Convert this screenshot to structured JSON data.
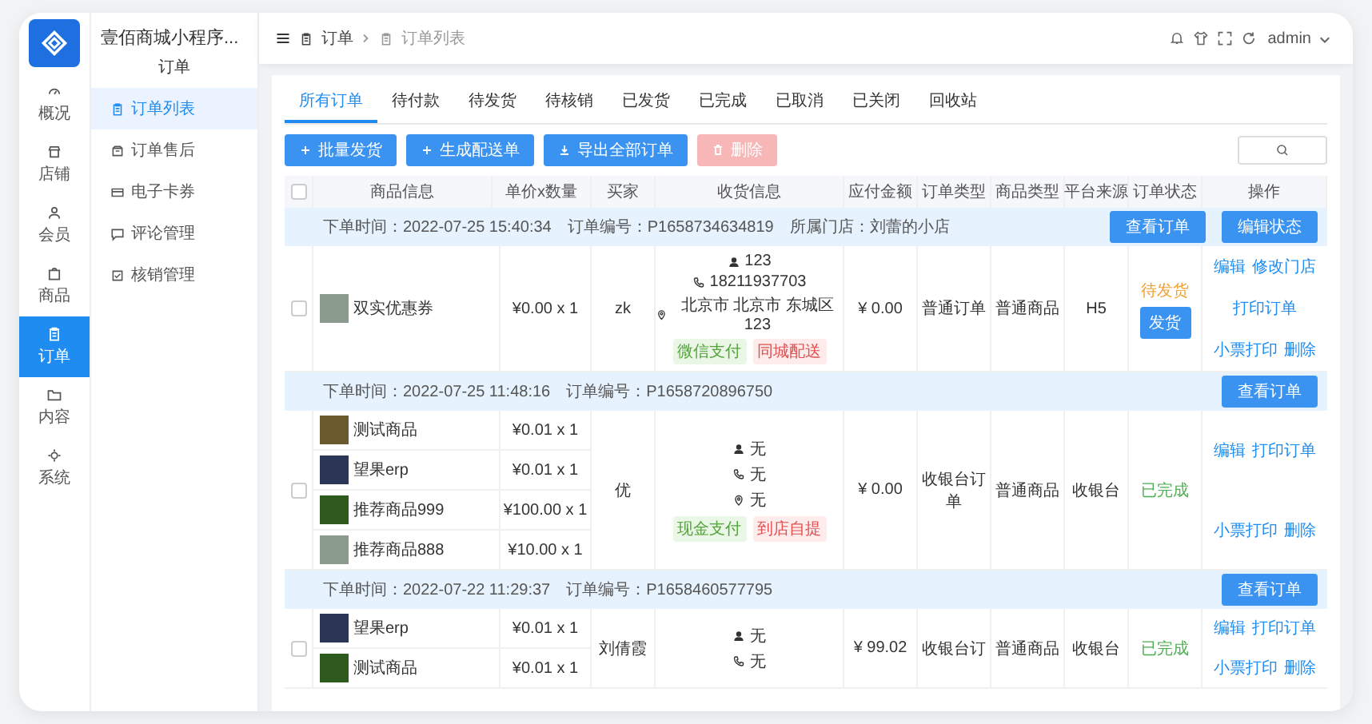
{
  "brand": {
    "title": "壹佰商城小程序..."
  },
  "rail": [
    {
      "label": "概况",
      "kind": "gauge",
      "selected": false
    },
    {
      "label": "店铺",
      "kind": "shop",
      "selected": false
    },
    {
      "label": "会员",
      "kind": "user",
      "selected": false
    },
    {
      "label": "商品",
      "kind": "bag",
      "selected": false
    },
    {
      "label": "订单",
      "kind": "order",
      "selected": true
    },
    {
      "label": "内容",
      "kind": "folder",
      "selected": false
    },
    {
      "label": "系统",
      "kind": "gear",
      "selected": false
    }
  ],
  "subnav": {
    "title": "订单",
    "items": [
      {
        "label": "订单列表",
        "kind": "list",
        "selected": true
      },
      {
        "label": "订单售后",
        "kind": "aftersale",
        "selected": false
      },
      {
        "label": "电子卡券",
        "kind": "card",
        "selected": false
      },
      {
        "label": "评论管理",
        "kind": "comment",
        "selected": false
      },
      {
        "label": "核销管理",
        "kind": "verify",
        "selected": false
      }
    ]
  },
  "breadcrumb": [
    "订单",
    "订单列表"
  ],
  "user": {
    "name": "admin"
  },
  "tabs": [
    {
      "label": "所有订单",
      "selected": true
    },
    {
      "label": "待付款",
      "selected": false
    },
    {
      "label": "待发货",
      "selected": false
    },
    {
      "label": "待核销",
      "selected": false
    },
    {
      "label": "已发货",
      "selected": false
    },
    {
      "label": "已完成",
      "selected": false
    },
    {
      "label": "已取消",
      "selected": false
    },
    {
      "label": "已关闭",
      "selected": false
    },
    {
      "label": "回收站",
      "selected": false
    }
  ],
  "toolbar": [
    {
      "label": "批量发货",
      "kind": "plus",
      "disabled": false
    },
    {
      "label": "生成配送单",
      "kind": "plus",
      "disabled": false
    },
    {
      "label": "导出全部订单",
      "kind": "download",
      "disabled": false
    },
    {
      "label": "删除",
      "kind": "trash",
      "disabled": true
    }
  ],
  "table": {
    "checked": false,
    "columns": [
      "商品信息",
      "单价x数量",
      "买家",
      "收货信息",
      "应付金额",
      "订单类型",
      "商品类型",
      "平台来源",
      "订单状态",
      "操作"
    ]
  },
  "orders": [
    {
      "checked": false,
      "meta": [
        "下单时间：2022-07-25 15:40:34",
        "订单编号：P1658734634819",
        "所属门店：刘蕾的小店"
      ],
      "actions": [
        "查看订单",
        "编辑状态"
      ],
      "products": [
        {
          "name": "双实优惠券",
          "price": "¥0.00 x 1"
        }
      ],
      "buyer": "zk",
      "receiver": [
        {
          "kind": "person",
          "text": "123"
        },
        {
          "kind": "phone",
          "text": "18211937703"
        },
        {
          "kind": "pin",
          "text": "北京市 北京市 东城区 123"
        }
      ],
      "tags": [
        {
          "label": "微信支付",
          "kind": "pay"
        },
        {
          "label": "同城配送",
          "kind": "delivery"
        }
      ],
      "amount": "¥ 0.00",
      "order_type": "普通订单",
      "goods_type": "普通商品",
      "platform": "H5",
      "status": {
        "label": "待发货",
        "kind": "pending"
      },
      "ship_button": "发货",
      "operations": [
        "编辑",
        "修改门店",
        "打印订单",
        "小票打印",
        "删除"
      ]
    },
    {
      "checked": false,
      "meta": [
        "下单时间：2022-07-25 11:48:16",
        "订单编号：P1658720896750"
      ],
      "actions": [
        "查看订单"
      ],
      "products": [
        {
          "name": "测试商品",
          "price": "¥0.01 x 1"
        },
        {
          "name": "望果erp",
          "price": "¥0.01 x 1"
        },
        {
          "name": "推荐商品999",
          "price": "¥100.00 x 1"
        },
        {
          "name": "推荐商品888",
          "price": "¥10.00 x 1"
        }
      ],
      "buyer": "优",
      "receiver": [
        {
          "kind": "person",
          "text": "无"
        },
        {
          "kind": "phone",
          "text": "无"
        },
        {
          "kind": "pin",
          "text": "无"
        }
      ],
      "tags": [
        {
          "label": "现金支付",
          "kind": "pay"
        },
        {
          "label": "到店自提",
          "kind": "delivery"
        }
      ],
      "amount": "¥ 0.00",
      "order_type": "收银台订单",
      "goods_type": "普通商品",
      "platform": "收银台",
      "status": {
        "label": "已完成",
        "kind": "done"
      },
      "operations": [
        "编辑",
        "打印订单",
        "小票打印",
        "删除"
      ]
    },
    {
      "checked": false,
      "meta": [
        "下单时间：2022-07-22 11:29:37",
        "订单编号：P1658460577795"
      ],
      "actions": [
        "查看订单"
      ],
      "products": [
        {
          "name": "望果erp",
          "price": "¥0.01 x 1"
        },
        {
          "name": "测试商品",
          "price": "¥0.01 x 1"
        }
      ],
      "buyer": "刘倩霞",
      "receiver": [
        {
          "kind": "person",
          "text": "无"
        },
        {
          "kind": "phone",
          "text": "无"
        }
      ],
      "amount": "¥ 99.02",
      "order_type": "收银台订",
      "goods_type": "普通商品",
      "platform": "收银台",
      "status": {
        "label": "已完成",
        "kind": "done"
      },
      "operations": [
        "编辑",
        "打印订单",
        "小票打印",
        "删除"
      ]
    }
  ]
}
